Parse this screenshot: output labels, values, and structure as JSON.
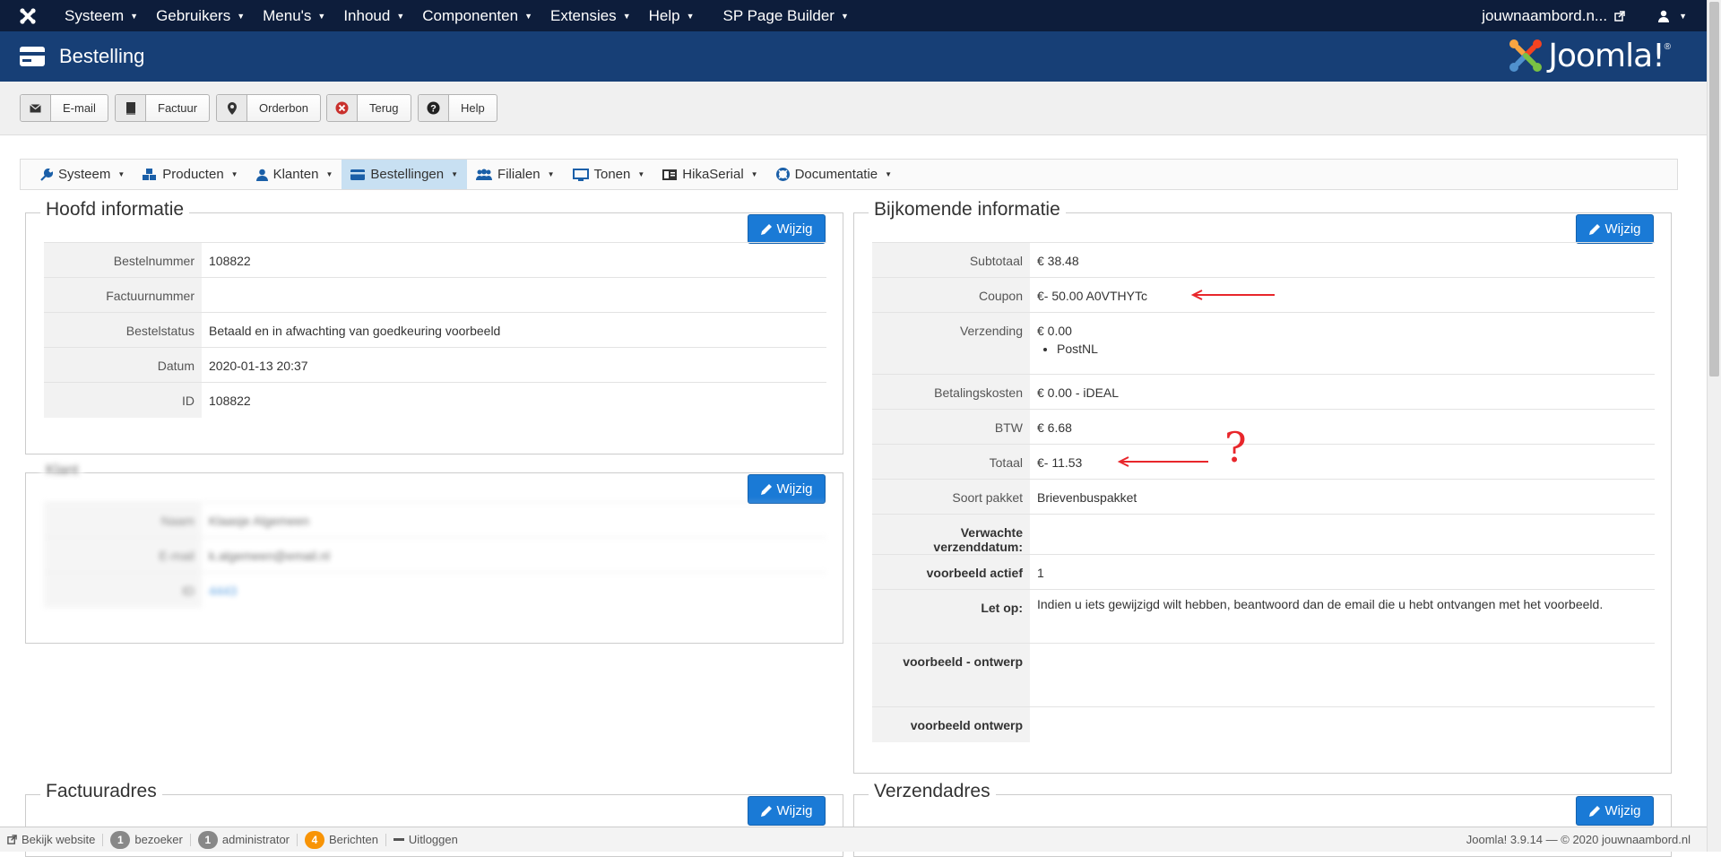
{
  "topnav": {
    "items": [
      "Systeem",
      "Gebruikers",
      "Menu's",
      "Inhoud",
      "Componenten",
      "Extensies",
      "Help",
      "SP Page Builder"
    ],
    "site_link": "jouwnaambord.n...",
    "user_icon": "user-icon"
  },
  "header": {
    "title": "Bestelling",
    "brand": "Joomla!",
    "brand_mark": "®"
  },
  "toolbar": {
    "email": "E-mail",
    "invoice": "Factuur",
    "order_slip": "Orderbon",
    "back": "Terug",
    "help": "Help"
  },
  "subnav": {
    "items": [
      {
        "label": "Systeem",
        "icon": "wrench-icon"
      },
      {
        "label": "Producten",
        "icon": "cubes-icon"
      },
      {
        "label": "Klanten",
        "icon": "user-icon"
      },
      {
        "label": "Bestellingen",
        "icon": "credit-card-icon"
      },
      {
        "label": "Filialen",
        "icon": "users-icon"
      },
      {
        "label": "Tonen",
        "icon": "monitor-icon"
      },
      {
        "label": "HikaSerial",
        "icon": "serial-icon"
      },
      {
        "label": "Documentatie",
        "icon": "lifebuoy-icon"
      }
    ],
    "active": "Bestellingen"
  },
  "edit_label": "Wijzig",
  "main_info": {
    "legend": "Hoofd informatie",
    "rows": [
      {
        "key": "Bestelnummer",
        "value": "108822"
      },
      {
        "key": "Factuurnummer",
        "value": ""
      },
      {
        "key": "Bestelstatus",
        "value": "Betaald en in afwachting van goedkeuring voorbeeld"
      },
      {
        "key": "Datum",
        "value": "2020-01-13 20:37"
      },
      {
        "key": "ID",
        "value": "108822"
      }
    ]
  },
  "customer": {
    "legend": "Klant",
    "rows": [
      {
        "key": "Naam",
        "value": "Klaasje Algemeen"
      },
      {
        "key": "E-mail",
        "value": "k.algemeen@email.nl"
      },
      {
        "key": "ID",
        "value": "4443"
      }
    ]
  },
  "additional_info": {
    "legend": "Bijkomende informatie",
    "subtotal_label": "Subtotaal",
    "subtotal": "€ 38.48",
    "coupon_label": "Coupon",
    "coupon": "€- 50.00 A0VTHYTc",
    "shipping_label": "Verzending",
    "shipping": "€ 0.00",
    "shipping_method": "PostNL",
    "payment_fee_label": "Betalingskosten",
    "payment_fee": "€ 0.00 - iDEAL",
    "vat_label": "BTW",
    "vat": "€ 6.68",
    "total_label": "Totaal",
    "total": "€- 11.53",
    "package_label": "Soort pakket",
    "package": "Brievenbuspakket",
    "expected_label": "Verwachte verzenddatum:",
    "expected": "",
    "active_label": "voorbeeld actief",
    "active": "1",
    "note_label": "Let op:",
    "note": "Indien u iets gewijzigd wilt hebben, beantwoord dan de email die u hebt ontvangen met het voorbeeld.",
    "design_label": "voorbeeld - ontwerp",
    "design": "",
    "design2_label": "voorbeeld ontwerp",
    "design2": ""
  },
  "annotation": {
    "question_mark": "?",
    "color": "#e8262b"
  },
  "billing": {
    "legend": "Factuuradres"
  },
  "shipping_addr": {
    "legend": "Verzendadres"
  },
  "statusbar": {
    "view_site": "Bekijk website",
    "visitors_count": "1",
    "visitors": "bezoeker",
    "admins_count": "1",
    "admins": "administrator",
    "messages_count": "4",
    "messages": "Berichten",
    "logout": "Uitloggen",
    "version": "Joomla! 3.9.14 — © 2020 jouwnaambord.nl"
  },
  "colors": {
    "topbar": "#0d1d3b",
    "titlebar": "#173f76",
    "button_primary": "#1a7ad6",
    "active_tab": "#c8e0f2"
  }
}
